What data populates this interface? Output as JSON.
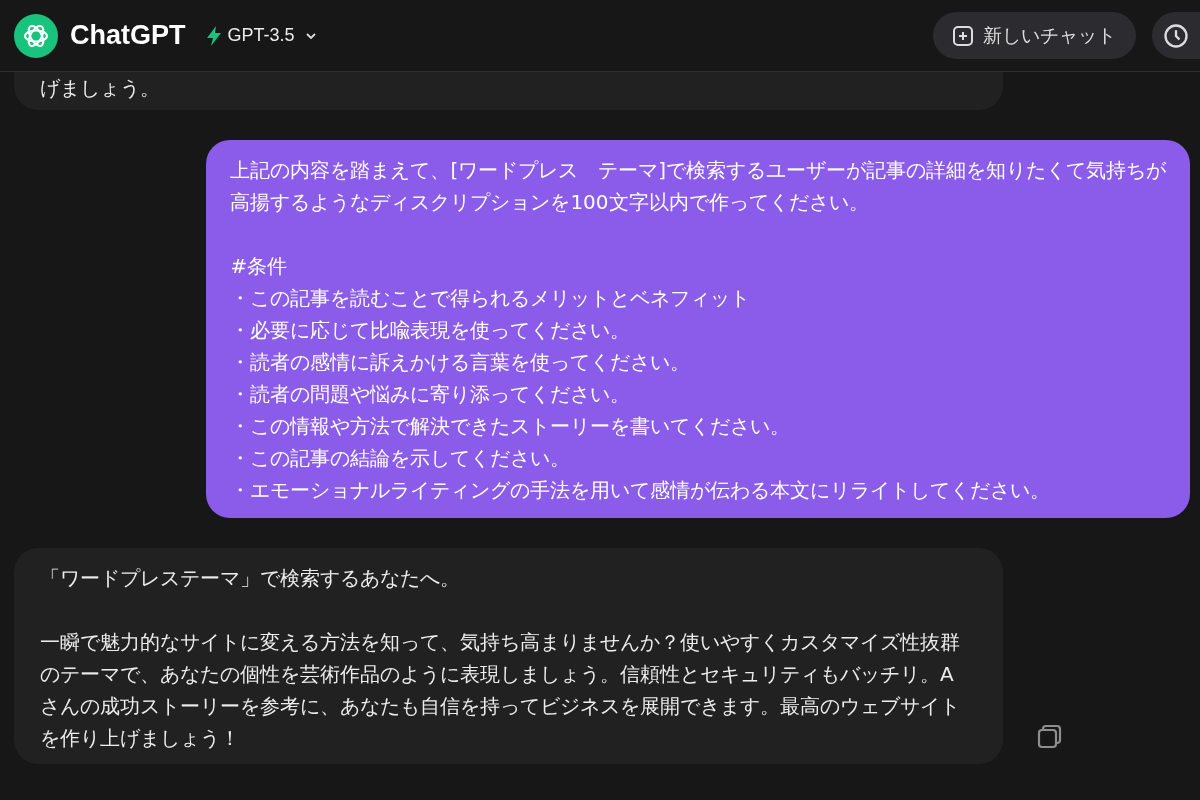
{
  "header": {
    "brand": "ChatGPT",
    "model": "GPT-3.5",
    "new_chat": "新しいチャット"
  },
  "messages": [
    {
      "kind": "assistant",
      "paragraphs": [
        [
          "げましょう。"
        ]
      ]
    },
    {
      "kind": "user",
      "paragraphs": [
        [
          "上記の内容を踏まえて、[ワードプレス　テーマ]で検索するユーザーが記事の詳細を知りたくて気持ちが",
          "高揚するようなディスクリプションを100文字以内で作ってください。"
        ],
        [
          "#条件",
          "・この記事を読むことで得られるメリットとベネフィット",
          "・必要に応じて比喩表現を使ってください。",
          "・読者の感情に訴えかける言葉を使ってください。",
          "・読者の問題や悩みに寄り添ってください。",
          "・この情報や方法で解決できたストーリーを書いてください。",
          "・この記事の結論を示してください。",
          "・エモーショナルライティングの手法を用いて感情が伝わる本文にリライトしてください。"
        ]
      ]
    },
    {
      "kind": "assistant",
      "copy": true,
      "paragraphs": [
        [
          "「ワードプレステーマ」で検索するあなたへ。"
        ],
        [
          "一瞬で魅力的なサイトに変える方法を知って、気持ち高まりませんか？使いやすくカスタマイズ性抜群",
          "のテーマで、あなたの個性を芸術作品のように表現しましょう。信頼性とセキュリティもバッチリ。A",
          "さんの成功ストーリーを参考に、あなたも自信を持ってビジネスを展開できます。最高のウェブサイト",
          "を作り上げましょう！"
        ]
      ]
    }
  ]
}
